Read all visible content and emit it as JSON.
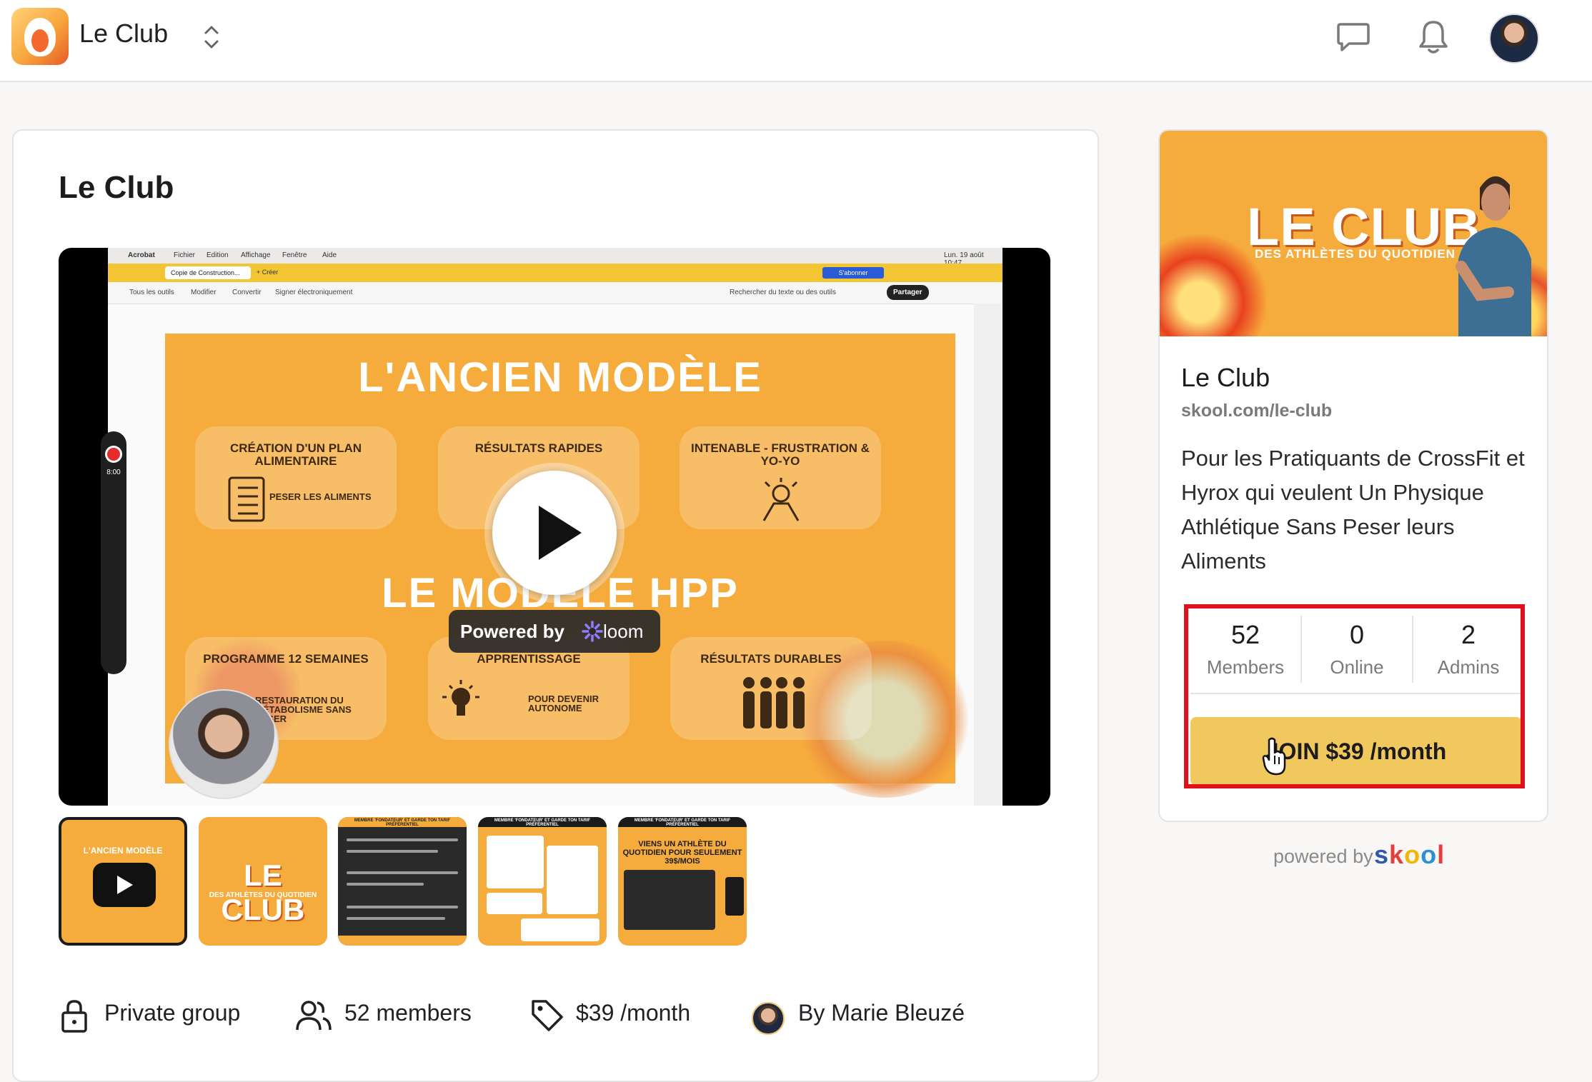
{
  "header": {
    "app_title": "Le Club",
    "icons": [
      "club-logo",
      "switcher-chevrons-icon",
      "chat-icon",
      "bell-icon",
      "user-avatar"
    ]
  },
  "main": {
    "title": "Le Club",
    "video": {
      "menubar": [
        "Acrobat",
        "Fichier",
        "Edition",
        "Affichage",
        "Fenêtre",
        "Aide"
      ],
      "clock": "Lun. 19 août 10:47",
      "tab_label": "Copie de Construction...",
      "new_tab": "+ Créer",
      "subscribe_label": "S'abonner",
      "toolbar": [
        "Tous les outils",
        "Modifier",
        "Convertir",
        "Signer électroniquement"
      ],
      "search_hint": "Rechercher du texte ou des outils",
      "share_label": "Partager",
      "slide": {
        "heading": "L'ANCIEN MODÈLE",
        "box1_title": "CRÉATION D'UN PLAN ALIMENTAIRE",
        "box1_sub": "PESER LES ALIMENTS",
        "box2_title": "RÉSULTATS RAPIDES",
        "box3_title": "INTENABLE - FRUSTRATION & YO-YO",
        "heading2": "LE MODÈLE HPP",
        "box4_title": "PROGRAMME 12 SEMAINES",
        "box4_sub": "RESTAURATION DU MÉTABOLISME SANS PESER",
        "box5_title": "APPRENTISSAGE",
        "box5_sub": "POUR DEVENIR AUTONOME",
        "box6_title": "RÉSULTATS DURABLES"
      },
      "timer": "8:00",
      "powered_by": "Powered by",
      "loom": "loom"
    },
    "thumbnails": {
      "t1_title": "L'ANCIEN MODÈLE",
      "t2_title": "LE CLUB",
      "t2_sub": "DES ATHLÈTES DU QUOTIDIEN",
      "t3_header": "MEMBRE 'FONDATEUR' ET GARDE TON TARIF PRÉFÉRENTIEL",
      "t4_header": "MEMBRE 'FONDATEUR' ET GARDE TON TARIF PRÉFÉRENTIEL",
      "t5_header": "MEMBRE 'FONDATEUR' ET GARDE TON TARIF PRÉFÉRENTIEL",
      "t5_title": "VIENS UN ATHLÈTE DU QUOTIDIEN POUR SEULEMENT 39$/MOIS"
    },
    "meta": {
      "privacy": "Private group",
      "members": "52 members",
      "price": "$39 /month",
      "author": "By Marie Bleuzé"
    }
  },
  "sidebar": {
    "banner_title": "LE CLUB",
    "banner_sub": "DES ATHLÈTES DU QUOTIDIEN",
    "name": "Le Club",
    "url": "skool.com/le-club",
    "description": "Pour les Pratiquants de CrossFit et Hyrox qui veulent Un Physique Athlétique Sans Peser leurs Aliments",
    "stats": [
      {
        "value": "52",
        "label": "Members"
      },
      {
        "value": "0",
        "label": "Online"
      },
      {
        "value": "2",
        "label": "Admins"
      }
    ],
    "join_label": "JOIN $39 /month"
  },
  "footer": {
    "powered_by": "powered by",
    "brand_letters": [
      "s",
      "k",
      "o",
      "o",
      "l"
    ],
    "brand_colors": [
      "#2e5aa8",
      "#e43f3f",
      "#f2b705",
      "#2b8fd6",
      "#e43f3f"
    ]
  },
  "colors": {
    "accent_yellow": "#f0c85e",
    "highlight_red": "#e0111a",
    "slide_orange": "#f6ac3d"
  }
}
